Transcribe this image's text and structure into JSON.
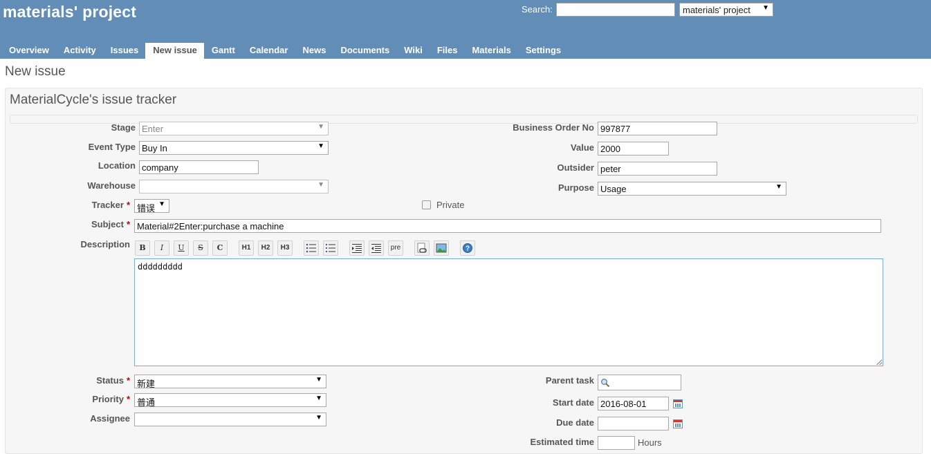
{
  "header": {
    "project_title": "materials' project",
    "search_label": "Search:",
    "search_value": "",
    "project_jump": "materials' project"
  },
  "tabs": [
    {
      "label": "Overview"
    },
    {
      "label": "Activity"
    },
    {
      "label": "Issues"
    },
    {
      "label": "New issue",
      "selected": true
    },
    {
      "label": "Gantt"
    },
    {
      "label": "Calendar"
    },
    {
      "label": "News"
    },
    {
      "label": "Documents"
    },
    {
      "label": "Wiki"
    },
    {
      "label": "Files"
    },
    {
      "label": "Materials"
    },
    {
      "label": "Settings"
    }
  ],
  "page": {
    "title": "New issue",
    "tracker_title": "MaterialCycle's issue tracker"
  },
  "form": {
    "stage": {
      "label": "Stage",
      "value": "Enter"
    },
    "event_type": {
      "label": "Event Type",
      "value": "Buy In"
    },
    "location": {
      "label": "Location",
      "value": "company"
    },
    "warehouse": {
      "label": "Warehouse",
      "value": ""
    },
    "tracker": {
      "label": "Tracker",
      "value": "错误"
    },
    "subject": {
      "label": "Subject",
      "value": "Material#2Enter:purchase a machine"
    },
    "description": {
      "label": "Description",
      "value": "ddddddddd"
    },
    "business_order": {
      "label": "Business Order No",
      "value": "997877"
    },
    "value": {
      "label": "Value",
      "value": "2000"
    },
    "outsider": {
      "label": "Outsider",
      "value": "peter"
    },
    "purpose": {
      "label": "Purpose",
      "value": "Usage"
    },
    "private": {
      "label": "Private",
      "checked": false
    },
    "status": {
      "label": "Status",
      "value": "新建"
    },
    "priority": {
      "label": "Priority",
      "value": "普通"
    },
    "assignee": {
      "label": "Assignee",
      "value": ""
    },
    "parent_task": {
      "label": "Parent task",
      "value": ""
    },
    "start_date": {
      "label": "Start date",
      "value": "2016-08-01"
    },
    "due_date": {
      "label": "Due date",
      "value": ""
    },
    "estimated_time": {
      "label": "Estimated time",
      "value": "",
      "unit": "Hours"
    },
    "required_marker": "*"
  },
  "toolbar": {
    "bold": "B",
    "italic": "I",
    "underline": "U",
    "strike": "S",
    "code": "C",
    "h1": "H1",
    "h2": "H2",
    "h3": "H3",
    "pre": "pre"
  },
  "icons": {
    "toolbar": [
      "bold-icon",
      "italic-icon",
      "underline-icon",
      "strikethrough-icon",
      "inline-code-icon",
      "heading1-icon",
      "heading2-icon",
      "heading3-icon",
      "bullet-list-icon",
      "numbered-list-icon",
      "indent-icon",
      "outdent-icon",
      "preformatted-icon",
      "link-icon",
      "image-icon",
      "help-icon"
    ],
    "calendar": "calendar-icon",
    "search": "magnifier-icon"
  },
  "colors": {
    "header_bg": "#628db6",
    "required": "#bb0000",
    "focus_border": "#7ea8d0"
  }
}
